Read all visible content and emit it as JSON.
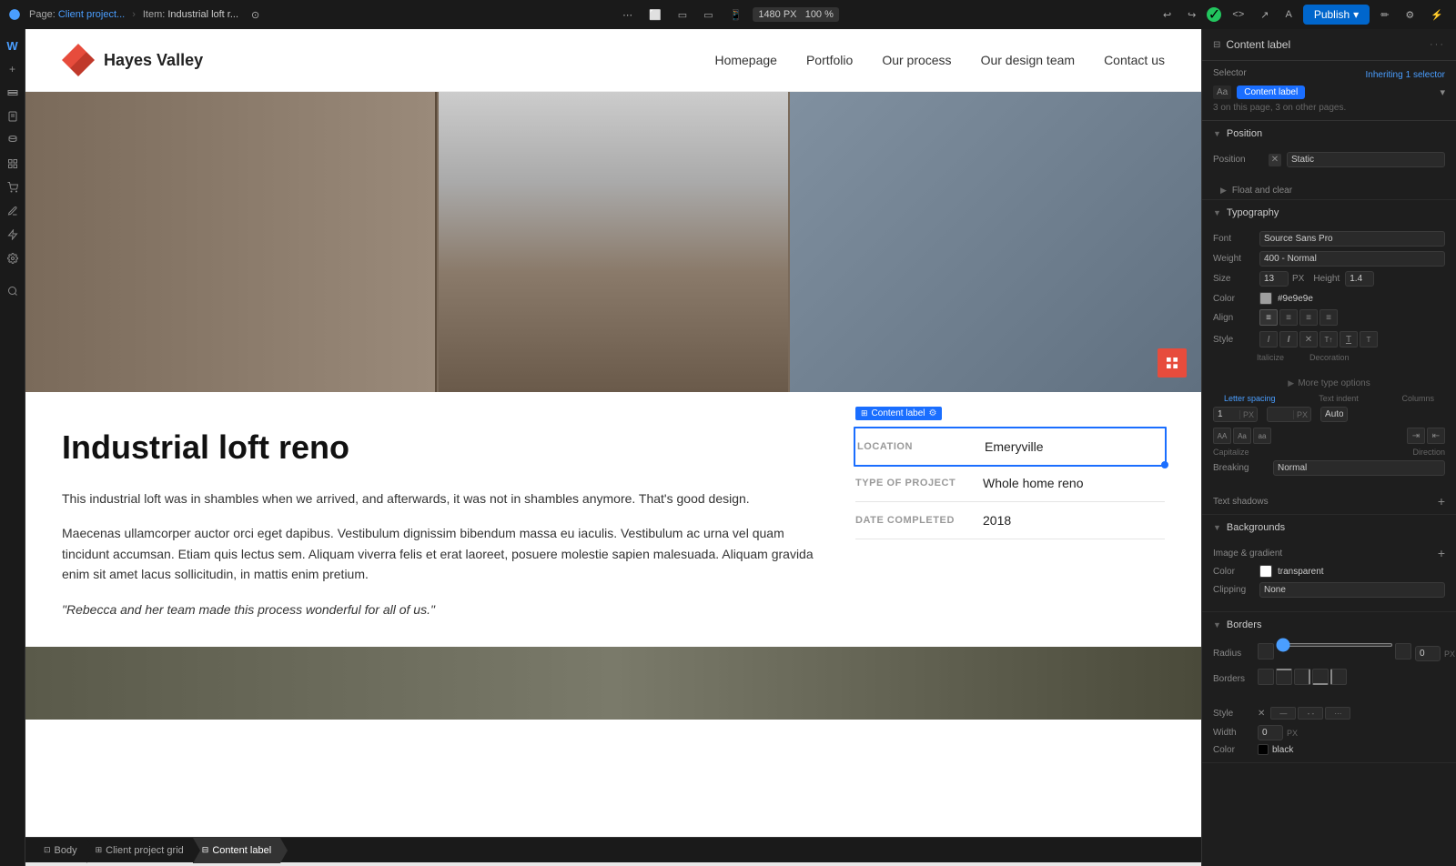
{
  "topbar": {
    "page_label": "Page:",
    "page_name": "Client project...",
    "item_label": "Item:",
    "item_name": "Industrial loft r...",
    "dimensions": "1480 PX",
    "zoom": "100 %",
    "publish_label": "Publish"
  },
  "breadcrumb": {
    "items": [
      "Body",
      "Client project grid",
      "Content label"
    ]
  },
  "site": {
    "logo_text": "Hayes Valley",
    "nav_links": [
      "Homepage",
      "Portfolio",
      "Our process",
      "Our design team",
      "Contact us"
    ],
    "hero_title": "Industrial loft reno",
    "body_text_1": "This industrial loft was in shambles when we arrived, and afterwards, it was not in shambles anymore. That's good design.",
    "body_text_2": "Maecenas ullamcorper auctor orci eget dapibus. Vestibulum dignissim bibendum massa eu iaculis. Vestibulum ac urna vel quam tincidunt accumsan. Etiam quis lectus sem. Aliquam viverra felis et erat laoreet, posuere molestie sapien malesuada. Aliquam gravida enim sit amet lacus sollicitudin, in mattis enim pretium.",
    "quote": "\"Rebecca and her team made this process wonderful for all of us.\"",
    "details": {
      "label_location": "LOCATION",
      "value_location": "Emeryville",
      "label_project": "TYPE OF PROJECT",
      "value_project": "Whole home reno",
      "label_date": "DATE COMPLETED",
      "value_date": "2018"
    }
  },
  "right_panel": {
    "title": "Content label",
    "selector_inheriting": "Inheriting",
    "selector_count": "1 selector",
    "selector_pages": "3 on this page, 3 on other pages.",
    "selector_badge": "Content label",
    "position_section": "Position",
    "position_label": "Position",
    "position_value": "Static",
    "position_float": "Float and clear",
    "typography_section": "Typography",
    "font_label": "Font",
    "font_value": "Source Sans Pro",
    "weight_label": "Weight",
    "weight_value": "400 - Normal",
    "size_label": "Size",
    "size_value": "13",
    "size_unit": "PX",
    "height_label": "Height",
    "height_value": "1.4",
    "color_label": "Color",
    "color_value": "#9e9e9e",
    "align_label": "Align",
    "style_label": "Style",
    "italicize_label": "Italicize",
    "decoration_label": "Decoration",
    "more_type_label": "More type options",
    "letter_spacing_label": "Letter spacing",
    "text_indent_label": "Text indent",
    "columns_label": "Columns",
    "capitalize_label": "Capitalize",
    "direction_label": "Direction",
    "breaking_label": "Breaking",
    "breaking_value": "Normal",
    "text_shadows_label": "Text shadows",
    "backgrounds_section": "Backgrounds",
    "img_gradient_label": "Image & gradient",
    "bg_color_label": "Color",
    "bg_color_value": "transparent",
    "clipping_label": "Clipping",
    "clipping_value": "None",
    "borders_section": "Borders",
    "radius_label": "Radius",
    "radius_value": "0",
    "radius_unit": "PX",
    "borders_label": "Borders",
    "style_borders_label": "Style",
    "width_label": "Width",
    "width_value": "0",
    "width_unit": "PX",
    "color_borders_label": "Color",
    "color_borders_value": "black"
  }
}
